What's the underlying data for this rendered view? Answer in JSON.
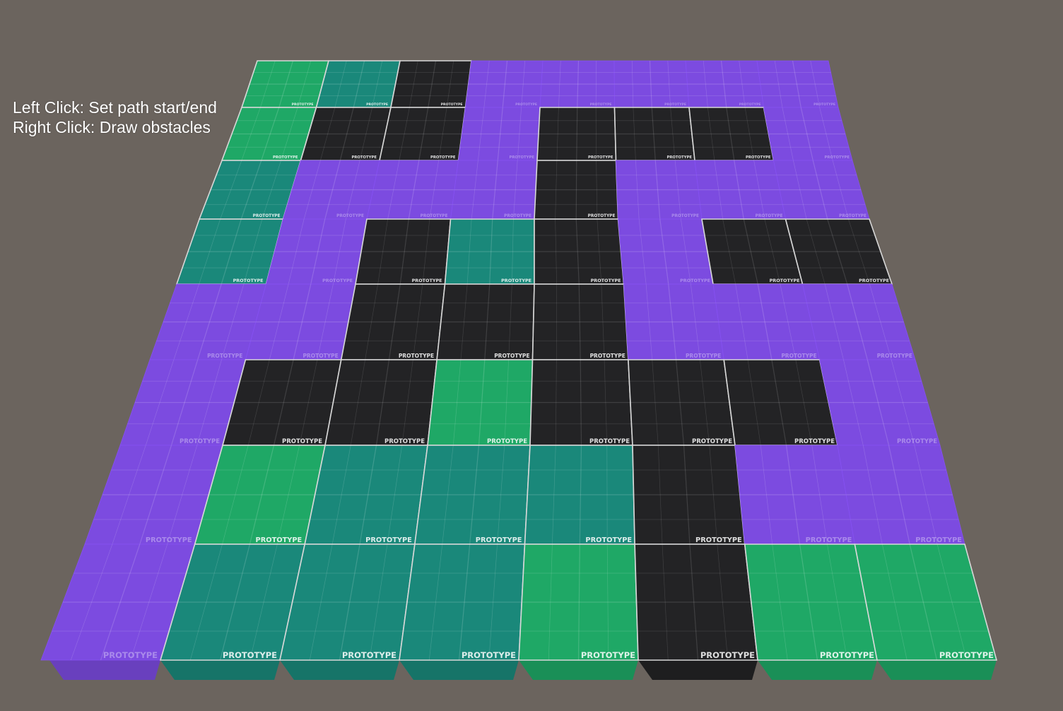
{
  "hud": {
    "line1": "Left Click: Set path start/end",
    "line2": "Right Click: Draw obstacles"
  },
  "texture_label": "PROTOTYPE",
  "colors": {
    "background": "#6b645e",
    "walkable": "#7c4be0",
    "obstacle": "#232325",
    "path": "#1fa866",
    "explored": "#1a887a",
    "tile_border": "#d8d8d8"
  },
  "legend_codes": {
    "W": "walkable",
    "O": "obstacle",
    "P": "path",
    "E": "explored"
  },
  "grid": {
    "rows": 8,
    "cols": 8,
    "cells": [
      [
        "P",
        "E",
        "O",
        "W",
        "W",
        "W",
        "W",
        "W"
      ],
      [
        "P",
        "O",
        "O",
        "W",
        "O",
        "O",
        "O",
        "W"
      ],
      [
        "E",
        "W",
        "W",
        "W",
        "O",
        "W",
        "W",
        "W"
      ],
      [
        "E",
        "W",
        "O",
        "E",
        "O",
        "W",
        "O",
        "O"
      ],
      [
        "W",
        "W",
        "O",
        "O",
        "O",
        "W",
        "W",
        "W"
      ],
      [
        "W",
        "O",
        "O",
        "P",
        "O",
        "O",
        "O",
        "W"
      ],
      [
        "W",
        "P",
        "E",
        "E",
        "E",
        "O",
        "W",
        "W"
      ],
      [
        "W",
        "E",
        "E",
        "E",
        "P",
        "O",
        "P",
        "P"
      ]
    ]
  }
}
